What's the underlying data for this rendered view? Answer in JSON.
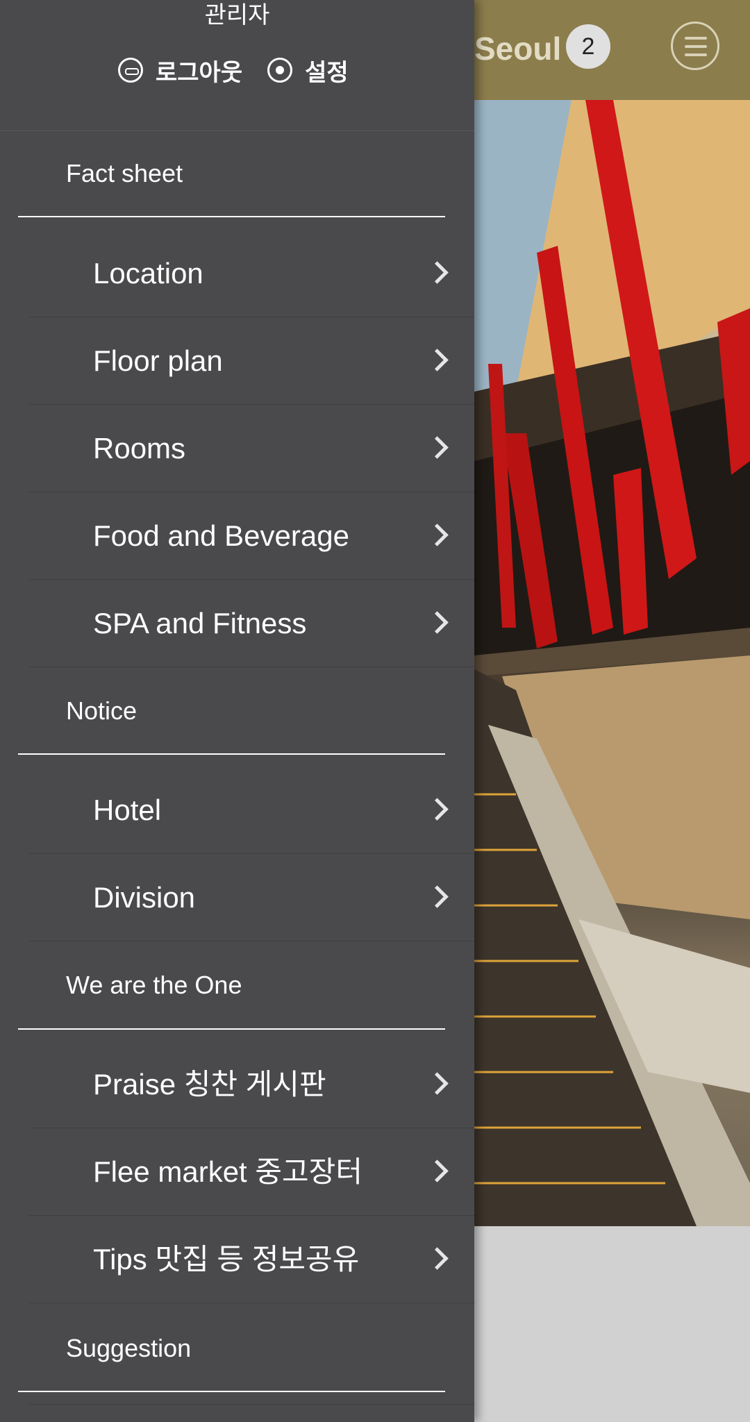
{
  "app": {
    "title": "Seoul",
    "badge_count": "2",
    "menu_icon": "hamburger-menu-icon"
  },
  "drawer": {
    "user_name": "관리자",
    "logout_label": "로그아웃",
    "settings_label": "설정",
    "sections": [
      {
        "title": "Fact sheet",
        "items": [
          "Location",
          "Floor plan",
          "Rooms",
          "Food and Beverage",
          "SPA and Fitness"
        ]
      },
      {
        "title": "Notice",
        "items": [
          "Hotel",
          "Division"
        ]
      },
      {
        "title": "We are the One",
        "items": [
          "Praise 칭찬 게시판",
          "Flee market 중고장터",
          "Tips 맛집 등 정보공유"
        ]
      },
      {
        "title": "Suggestion",
        "items": []
      }
    ]
  },
  "colors": {
    "drawer_bg": "#4a4a4d",
    "header_bg": "#8c7d4c",
    "accent_red": "#d01818"
  }
}
